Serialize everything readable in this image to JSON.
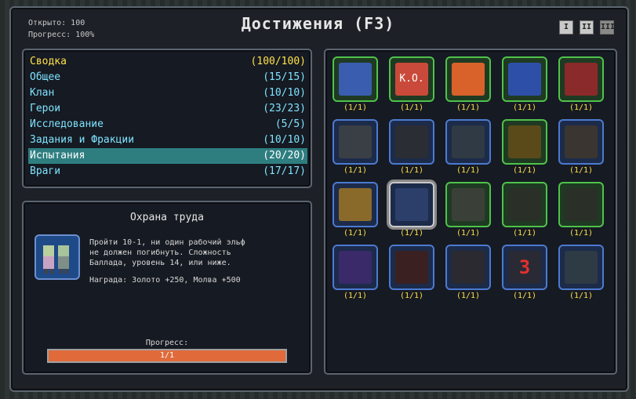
{
  "header": {
    "title": "Достижения (F3)",
    "opened_label": "Открыто: 100",
    "progress_label": "Прогресс: 100%"
  },
  "window_buttons": [
    "I",
    "II",
    "III"
  ],
  "categories": [
    {
      "name": "Сводка",
      "count": "(100/100)"
    },
    {
      "name": "Общее",
      "count": "(15/15)"
    },
    {
      "name": "Клан",
      "count": "(10/10)"
    },
    {
      "name": "Герои",
      "count": "(23/23)"
    },
    {
      "name": "Исследование",
      "count": "(5/5)"
    },
    {
      "name": "Задания и Фракции",
      "count": "(10/10)"
    },
    {
      "name": "Испытания",
      "count": "(20/20)"
    },
    {
      "name": "Враги",
      "count": "(17/17)"
    }
  ],
  "selected_category": "Испытания",
  "detail": {
    "title": "Охрана труда",
    "description": "Пройти 10-1, ни один рабочий эльф\nне должен погибнуть. Сложность\nБаллада, уровень 14, или ниже.",
    "reward": "Награда: Золото +250, Молва +500",
    "progress_label": "Прогресс:",
    "progress_text": "1/1",
    "progress_fraction": 1.0
  },
  "achievements": [
    {
      "count": "(1/1)",
      "frame": "green",
      "icon": "scroll-icon"
    },
    {
      "count": "(1/1)",
      "frame": "green",
      "icon": "ko-fist-icon",
      "glyph": "K.O."
    },
    {
      "count": "(1/1)",
      "frame": "green",
      "icon": "crossed-fire-icon"
    },
    {
      "count": "(1/1)",
      "frame": "green",
      "icon": "wheel-icon"
    },
    {
      "count": "(1/1)",
      "frame": "green",
      "icon": "crossed-potion-icon"
    },
    {
      "count": "(1/1)",
      "frame": "blue",
      "icon": "burst-icon"
    },
    {
      "count": "(1/1)",
      "frame": "blue",
      "icon": "rune-circle-icon"
    },
    {
      "count": "(1/1)",
      "frame": "blue",
      "icon": "water-drops-icon"
    },
    {
      "count": "(1/1)",
      "frame": "green",
      "icon": "gold-scroll-icon"
    },
    {
      "count": "(1/1)",
      "frame": "blue",
      "icon": "hourglass-icon"
    },
    {
      "count": "(1/1)",
      "frame": "blue",
      "icon": "pot-icon"
    },
    {
      "count": "(1/1)",
      "frame": "highlight",
      "icon": "elf-workers-icon"
    },
    {
      "count": "(1/1)",
      "frame": "green",
      "icon": "blood-wall-icon"
    },
    {
      "count": "(1/1)",
      "frame": "green",
      "icon": "prisoner-icon"
    },
    {
      "count": "(1/1)",
      "frame": "green",
      "icon": "trap-icon"
    },
    {
      "count": "(1/1)",
      "frame": "blue",
      "icon": "potions-icon"
    },
    {
      "count": "(1/1)",
      "frame": "blue",
      "icon": "crosshair-icon"
    },
    {
      "count": "(1/1)",
      "frame": "blue",
      "icon": "horn-icon"
    },
    {
      "count": "(1/1)",
      "frame": "blue",
      "icon": "cookie-three-icon",
      "glyph": "3"
    },
    {
      "count": "(1/1)",
      "frame": "blue",
      "icon": "shield-gem-icon"
    }
  ],
  "colors": {
    "green_frame": "#4fc24b",
    "blue_frame": "#4c7ad0",
    "count_text": "#ffe14a",
    "category_text": "#7ee3ff",
    "selected_bg": "#2e7e80",
    "progress_bar": "#e16a3b"
  }
}
